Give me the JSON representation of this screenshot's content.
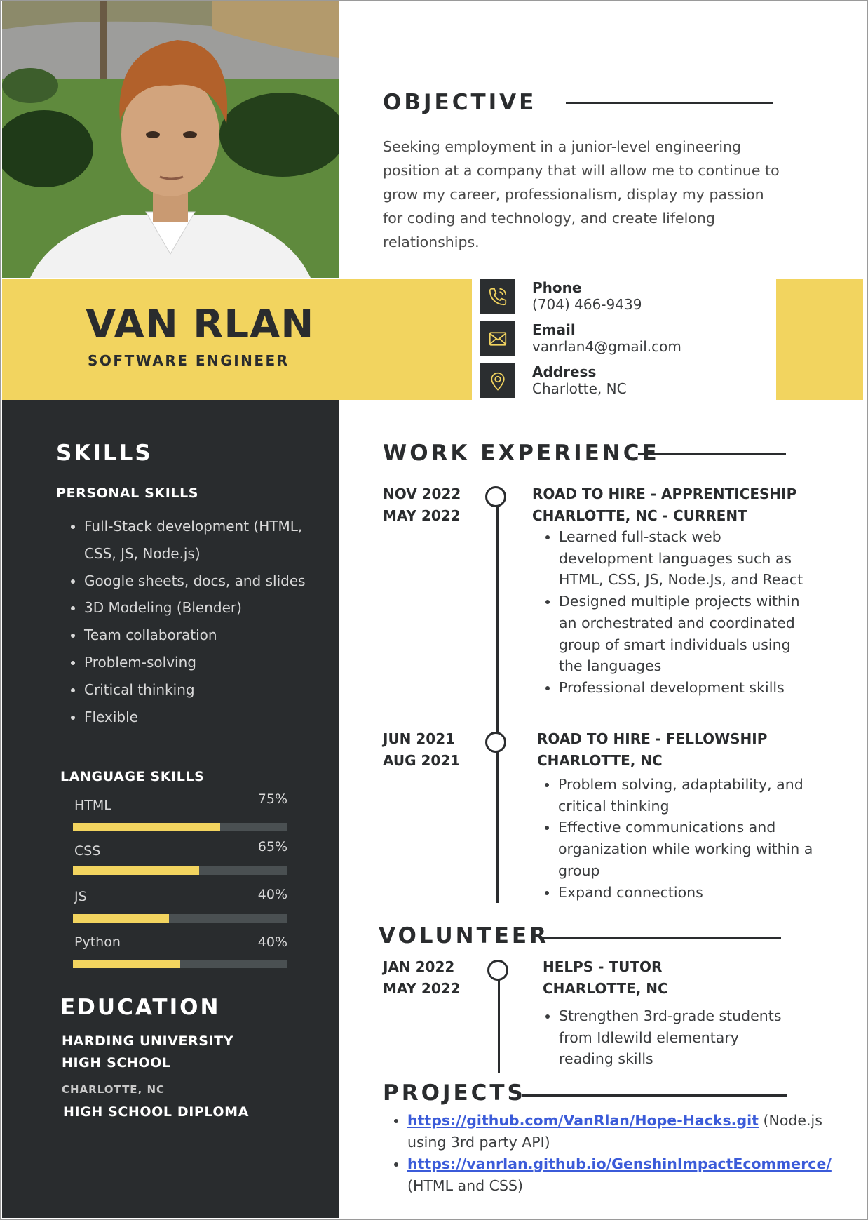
{
  "header": {
    "name": "VAN RLAN",
    "title": "SOFTWARE ENGINEER"
  },
  "objective": {
    "heading": "OBJECTIVE",
    "text": "Seeking employment in a junior-level engineering position at a company that will allow me to continue to grow my career, professionalism, display my passion for coding and technology, and create lifelong relationships."
  },
  "contact": [
    {
      "label": "Phone",
      "value": "(704) 466-9439",
      "icon": "phone-icon"
    },
    {
      "label": "Email",
      "value": "vanrlan4@gmail.com",
      "icon": "email-icon"
    },
    {
      "label": "Address",
      "value": "Charlotte, NC",
      "icon": "location-pin-icon"
    }
  ],
  "skills": {
    "heading": "SKILLS",
    "personal_heading": "PERSONAL SKILLS",
    "personal": [
      "Full-Stack development (HTML, CSS, JS, Node.js)",
      "Google sheets, docs, and slides",
      "3D Modeling (Blender)",
      "Team collaboration",
      "Problem-solving",
      "Critical thinking",
      "Flexible"
    ],
    "language_heading": "LANGUAGE SKILLS",
    "languages": [
      {
        "name": "HTML",
        "percent_label": "75%",
        "level": 0.69
      },
      {
        "name": "CSS",
        "percent_label": "65%",
        "level": 0.59
      },
      {
        "name": "JS",
        "percent_label": "40%",
        "level": 0.45
      },
      {
        "name": "Python",
        "percent_label": "40%",
        "level": 0.5
      }
    ]
  },
  "education": {
    "heading": "EDUCATION",
    "school_line1": "HARDING UNIVERSITY",
    "school_line2": "HIGH SCHOOL",
    "location": "CHARLOTTE, NC",
    "degree": "HIGH SCHOOL DIPLOMA"
  },
  "work": {
    "heading": "WORK EXPERIENCE",
    "jobs": [
      {
        "date_line1": "NOV 2022",
        "date_line2": "MAY 2022",
        "title_line1": "ROAD TO HIRE - APPRENTICESHIP",
        "title_line2": "CHARLOTTE, NC - CURRENT",
        "bullets": [
          "Learned full-stack web development languages such as HTML, CSS, JS, Node.Js, and React",
          "Designed multiple projects within an orchestrated and coordinated group of smart individuals using the languages",
          "Professional development skills"
        ]
      },
      {
        "date_line1": "JUN 2021",
        "date_line2": "AUG 2021",
        "title_line1": "ROAD TO HIRE - FELLOWSHIP",
        "title_line2": "CHARLOTTE, NC",
        "bullets": [
          "Problem solving, adaptability, and critical thinking",
          "Effective communications and organization while working within a group",
          "Expand connections"
        ]
      }
    ]
  },
  "volunteer": {
    "heading": "VOLUNTEER",
    "date_line1": "JAN 2022",
    "date_line2": "MAY 2022",
    "title_line1": "HELPS - TUTOR",
    "title_line2": "CHARLOTTE, NC",
    "bullets": [
      "Strengthen 3rd-grade students from Idlewild elementary reading skills"
    ]
  },
  "projects": {
    "heading": "PROJECTS",
    "items": [
      {
        "link": "https://github.com/VanRlan/Hope-Hacks.git",
        "desc": "(Node.js using 3rd party API)"
      },
      {
        "link": "https://vanrlan.github.io/GenshinImpactEcommerce/",
        "desc": "(HTML and CSS)"
      }
    ]
  },
  "colors": {
    "accent_yellow": "#f2d45f",
    "dark": "#292c2e",
    "link": "#3b5bd9"
  }
}
